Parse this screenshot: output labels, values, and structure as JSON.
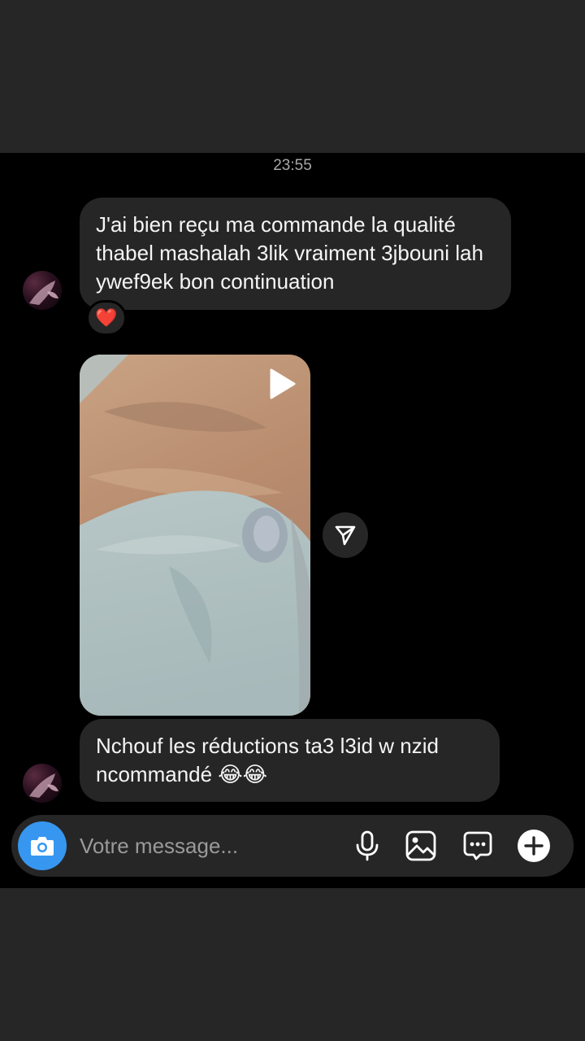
{
  "conversation": {
    "timestamp": "23:55",
    "messages": [
      {
        "type": "text",
        "text": "J'ai bien reçu ma commande la qualité thabel mashalah 3lik  vraiment 3jbouni lah ywef9ek bon continuation",
        "reaction": "❤️"
      },
      {
        "type": "video",
        "play_icon": "play-icon",
        "share_icon": "send-icon"
      },
      {
        "type": "text",
        "text": "Nchouf les réductions ta3 l3id w nzid ncommandé 😂😂"
      }
    ]
  },
  "composer": {
    "placeholder": "Votre message...",
    "value": "",
    "buttons": [
      "camera-icon",
      "microphone-icon",
      "gallery-icon",
      "sticker-icon",
      "plus-icon"
    ]
  },
  "colors": {
    "chat_background": "#000000",
    "bubble": "#262626",
    "accent": "#3797f0",
    "text": "#f5f5f5"
  }
}
